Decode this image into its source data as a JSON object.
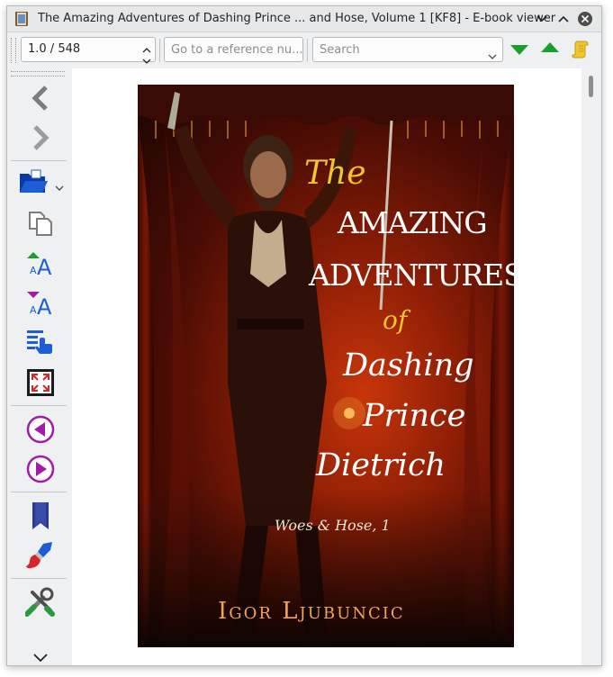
{
  "window": {
    "title": "The Amazing Adventures of Dashing Prince ... and Hose, Volume 1 [KF8] - E-book viewer"
  },
  "toolbar": {
    "position_value": "1.0 / 548",
    "reference_placeholder": "Go to a reference nu...",
    "search_placeholder": "Search"
  },
  "sidebar": {
    "items": [
      {
        "name": "back",
        "icon": "arrow-left-icon"
      },
      {
        "name": "forward",
        "icon": "arrow-right-icon"
      },
      {
        "name": "open-ebook",
        "icon": "folder-open-icon"
      },
      {
        "name": "copy",
        "icon": "copy-icon"
      },
      {
        "name": "increase-font-size",
        "icon": "font-increase-icon"
      },
      {
        "name": "decrease-font-size",
        "icon": "font-decrease-icon"
      },
      {
        "name": "table-of-contents",
        "icon": "toc-icon"
      },
      {
        "name": "full-screen",
        "icon": "fullscreen-icon"
      },
      {
        "name": "previous-page",
        "icon": "previous-page-icon"
      },
      {
        "name": "next-page",
        "icon": "next-page-icon"
      },
      {
        "name": "bookmarks",
        "icon": "bookmark-icon"
      },
      {
        "name": "theme",
        "icon": "brush-icon"
      },
      {
        "name": "preferences",
        "icon": "tools-icon"
      },
      {
        "name": "more",
        "icon": "chevron-down-icon"
      }
    ]
  },
  "cover": {
    "title_the": "The",
    "title_amazing": "AMAZING",
    "title_adventures": "ADVENTURES",
    "title_of": "of",
    "title_dashing": "Dashing",
    "title_prince": "Prince",
    "title_dietrich": "Dietrich",
    "series": "Woes & Hose, 1",
    "author": "Igor Ljubuncic"
  },
  "colors": {
    "accent_green": "#1a9f2c",
    "accent_blue": "#1d5ed6",
    "accent_purple": "#a21aa8",
    "cover_gold": "#f0c52e",
    "author_gold": "#f0a456"
  }
}
